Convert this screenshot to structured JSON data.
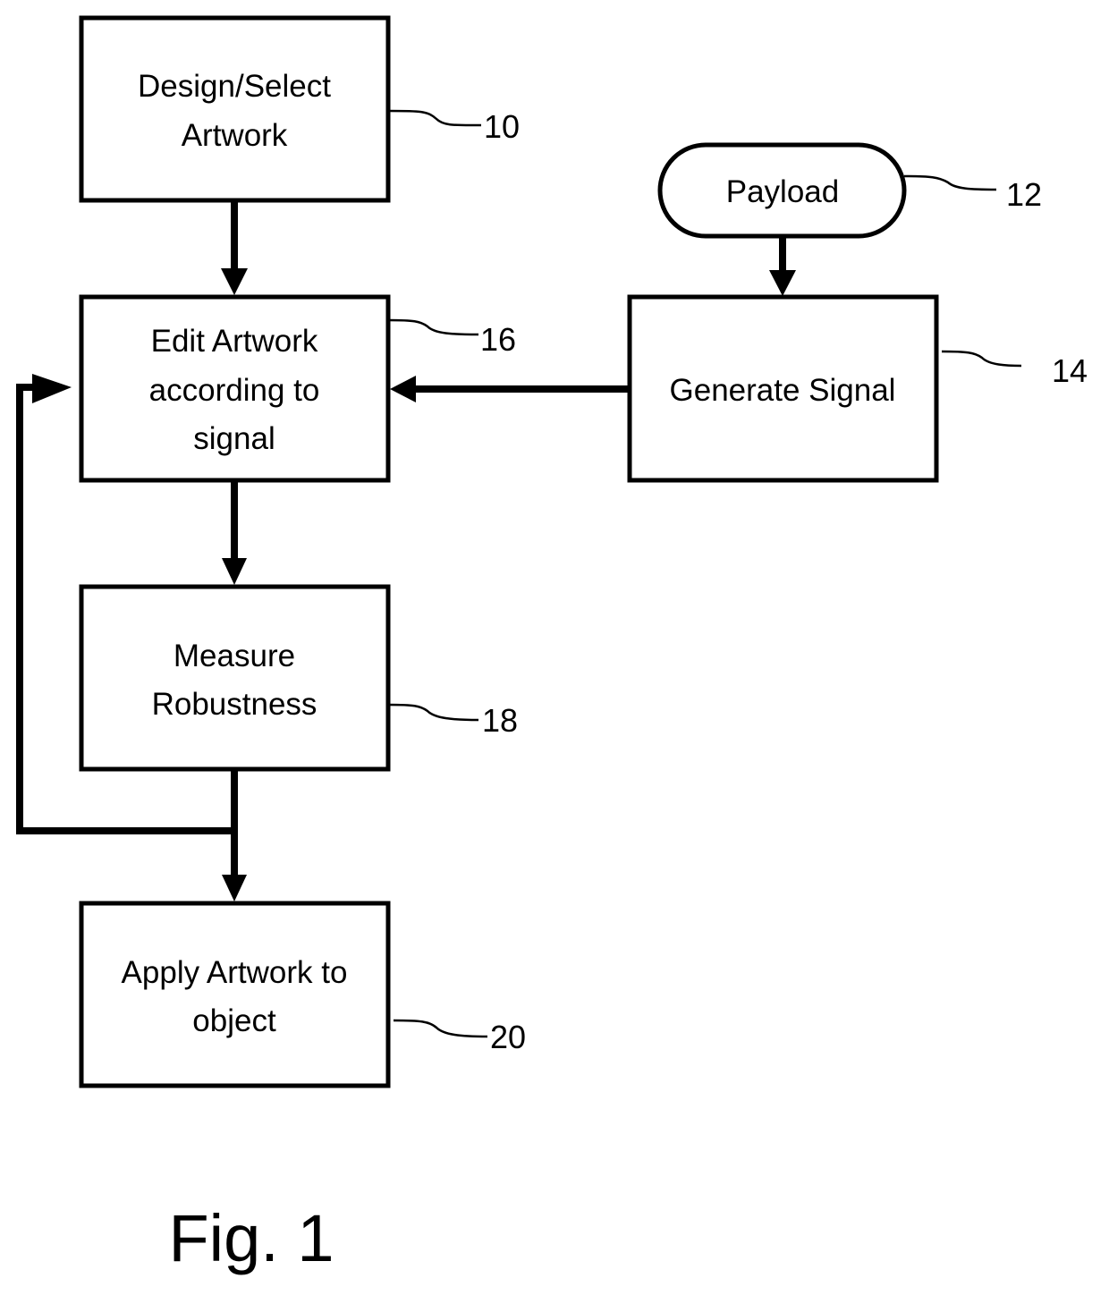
{
  "figure": {
    "caption": "Fig. 1",
    "nodes": [
      {
        "id": "10",
        "shape": "rect",
        "lines": [
          "Design/Select",
          "Artwork"
        ],
        "ref": "10"
      },
      {
        "id": "12",
        "shape": "terminator",
        "lines": [
          "Payload"
        ],
        "ref": "12"
      },
      {
        "id": "14",
        "shape": "rect",
        "lines": [
          "Generate Signal"
        ],
        "ref": "14"
      },
      {
        "id": "16",
        "shape": "rect",
        "lines": [
          "Edit Artwork",
          "according to",
          "signal"
        ],
        "ref": "16"
      },
      {
        "id": "18",
        "shape": "rect",
        "lines": [
          "Measure",
          "Robustness"
        ],
        "ref": "18"
      },
      {
        "id": "20",
        "shape": "rect",
        "lines": [
          "Apply Artwork to",
          "object"
        ],
        "ref": "20"
      }
    ],
    "edges": [
      {
        "from": "10",
        "to": "16"
      },
      {
        "from": "12",
        "to": "14"
      },
      {
        "from": "14",
        "to": "16"
      },
      {
        "from": "16",
        "to": "18"
      },
      {
        "from": "18",
        "to": "20"
      },
      {
        "from": "18",
        "to": "16",
        "type": "feedback-loop"
      }
    ],
    "colors": {
      "stroke": "#000000",
      "background": "#ffffff"
    }
  }
}
